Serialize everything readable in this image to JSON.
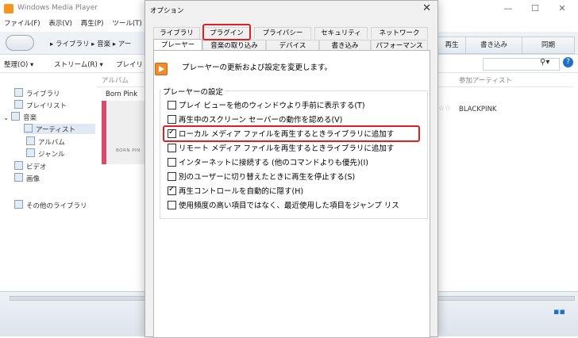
{
  "wmp": {
    "title": "Windows Media Player",
    "menu": [
      "ファイル(F)",
      "表示(V)",
      "再生(P)",
      "ツール(T)"
    ],
    "breadcrumb": "▸ ライブラリ ▸ 音楽 ▸ アー",
    "tabs_right": [
      "再生",
      "書き込み",
      "同期"
    ],
    "toolbar": {
      "organize": "整理(O) ▾",
      "stream": "ストリーム(R) ▾",
      "playlist": "プレイリ"
    },
    "search_icon": "search-icon",
    "columns": {
      "album": "アルバム",
      "artist": "参加アーティスト"
    },
    "album_name": "Born Pink",
    "album_caption": "BORN PIN",
    "artist_value": "BLACKPINK",
    "sidebar": [
      {
        "label": "ライブラリ",
        "icon": "library-icon"
      },
      {
        "label": "プレイリスト",
        "icon": "playlist-icon"
      },
      {
        "label": "音楽",
        "icon": "music-icon"
      },
      {
        "label": "アーティスト",
        "icon": "artist-icon"
      },
      {
        "label": "アルバム",
        "icon": "album-icon"
      },
      {
        "label": "ジャンル",
        "icon": "genre-icon"
      },
      {
        "label": "ビデオ",
        "icon": "video-icon"
      },
      {
        "label": "画像",
        "icon": "image-icon"
      },
      {
        "label": "その他のライブラリ",
        "icon": "other-library-icon"
      }
    ]
  },
  "dialog": {
    "title": "オプション",
    "tabs_row1": [
      "ライブラリ",
      "プラグイン",
      "プライバシー",
      "セキュリティ",
      "ネットワーク"
    ],
    "tabs_row2": [
      "プレーヤー",
      "音楽の取り込み",
      "デバイス",
      "書き込み",
      "パフォーマンス"
    ],
    "description": "プレーヤーの更新および設定を変更します。",
    "group_label": "プレーヤーの設定",
    "options": [
      {
        "label": "プレイ ビューを他のウィンドウより手前に表示する(T)",
        "checked": false
      },
      {
        "label": "再生中のスクリーン セーバーの動作を認める(V)",
        "checked": false
      },
      {
        "label": "ローカル メディア ファイルを再生するときライブラリに追加す",
        "checked": true
      },
      {
        "label": "リモート メディア ファイルを再生するときライブラリに追加す",
        "checked": false
      },
      {
        "label": "インターネットに接続する (他のコマンドよりも優先)(I)",
        "checked": false
      },
      {
        "label": "別のユーザーに切り替えたときに再生を停止する(S)",
        "checked": false
      },
      {
        "label": "再生コントロールを自動的に隠す(H)",
        "checked": true
      },
      {
        "label": "使用頻度の高い項目ではなく、最近使用した項目をジャンプ リス",
        "checked": false
      }
    ],
    "accent_color": "#e02020"
  }
}
